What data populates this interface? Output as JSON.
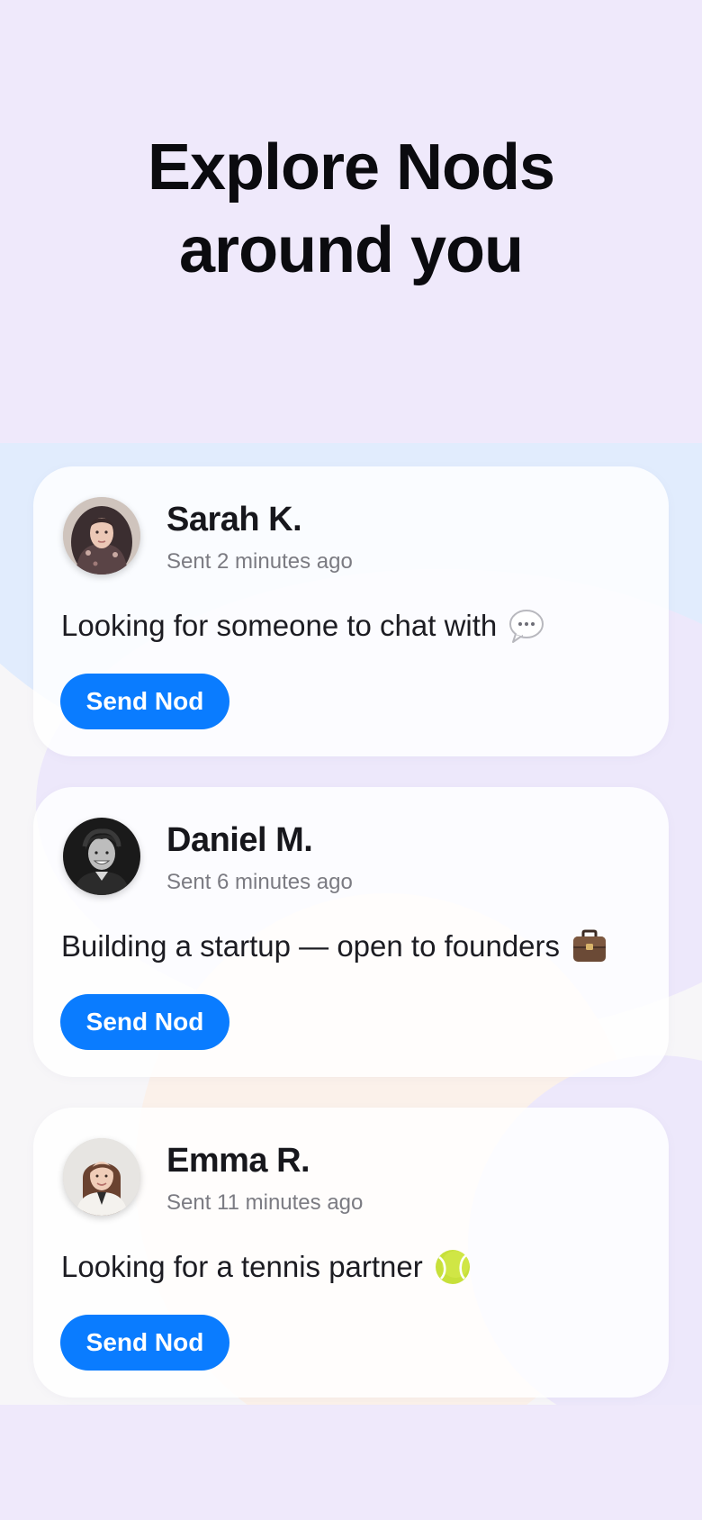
{
  "header": {
    "title_line1": "Explore Nods",
    "title_line2": "around you"
  },
  "cards": [
    {
      "name": "Sarah K.",
      "time": "Sent 2 minutes ago",
      "message": "Looking for someone to chat with",
      "emoji_icon": "speech-bubble-icon",
      "button_label": "Send Nod"
    },
    {
      "name": "Daniel M.",
      "time": "Sent 6 minutes ago",
      "message": "Building a startup — open to founders",
      "emoji_icon": "briefcase-icon",
      "button_label": "Send Nod"
    },
    {
      "name": "Emma R.",
      "time": "Sent 11 minutes ago",
      "message": "Looking for a tennis partner",
      "emoji_icon": "tennis-ball-icon",
      "button_label": "Send Nod"
    }
  ],
  "colors": {
    "accent": "#0a7cff",
    "hero_background": "#efe9fb",
    "title_text": "#0b0b0f",
    "secondary_text": "#7b7b82"
  }
}
